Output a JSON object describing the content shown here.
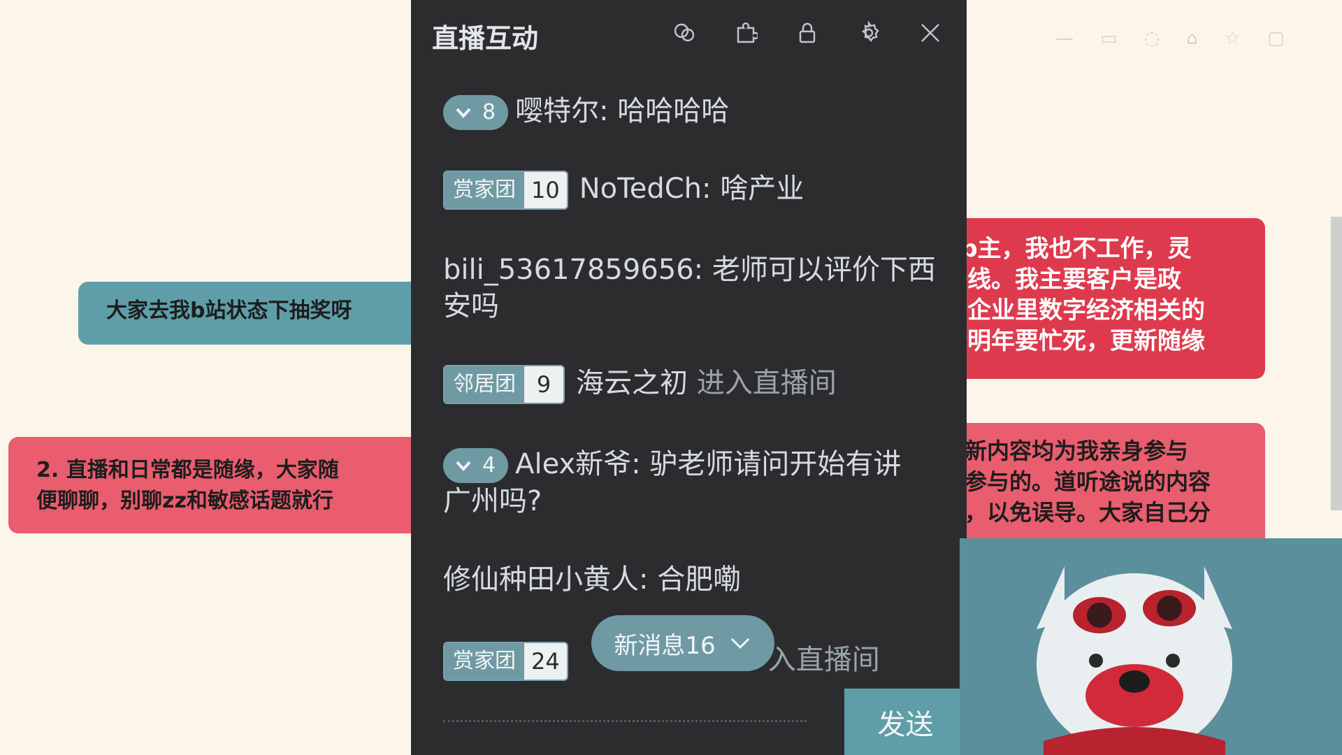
{
  "banners": {
    "left_top": "大家去我b站状态下抽奖呀",
    "left_bottom_line1": "2. 直播和日常都是随缘，大家随",
    "left_bottom_line2": "便聊聊，别聊zz和敏感话题就行",
    "right_top_line1": "up主，我也不工作，灵",
    "right_top_line2": "一线。我主要客户是政",
    "right_top_line3": "、企业里数字经济相关的",
    "right_top_line4": "计明年要忙死，更新随缘",
    "right_bottom_line1": "新内容均为我亲身参与",
    "right_bottom_line2": "参与的。道听途说的内容",
    "right_bottom_line3": "，以免误导。大家自己分"
  },
  "panel": {
    "title": "直播互动",
    "icons": [
      "bubble-icon",
      "puzzle-icon",
      "lock-icon",
      "gear-icon",
      "close-icon"
    ],
    "messages": [
      {
        "level": "8",
        "user": "嘤特尔",
        "text": "哈哈哈哈"
      },
      {
        "badge": "赏家团",
        "badge_level": "10",
        "user": "NoTedCh",
        "text": "啥产业"
      },
      {
        "user": "bili_53617859656",
        "text_line1": "老师可以评价下西",
        "text_line2": "安吗"
      },
      {
        "badge": "邻居团",
        "badge_level": "9",
        "user": "海云之初",
        "system": "进入直播间"
      },
      {
        "level": "4",
        "user": "Alex新爷",
        "text_line1": "驴老师请问开始有讲",
        "text_line2": "广州吗?"
      },
      {
        "user": "修仙种田小黄人",
        "text": "合肥嘞"
      },
      {
        "badge": "赏家团",
        "badge_level": "24",
        "system": "入直播间"
      }
    ],
    "new_messages_label": "新消息16",
    "send_label": "发送"
  },
  "colors": {
    "panel_bg": "#2c2c2e",
    "accent": "#6f9aa4",
    "banner_teal": "#5f9ea8",
    "banner_red": "#de3a4e",
    "page_bg": "#fbf5ea"
  }
}
